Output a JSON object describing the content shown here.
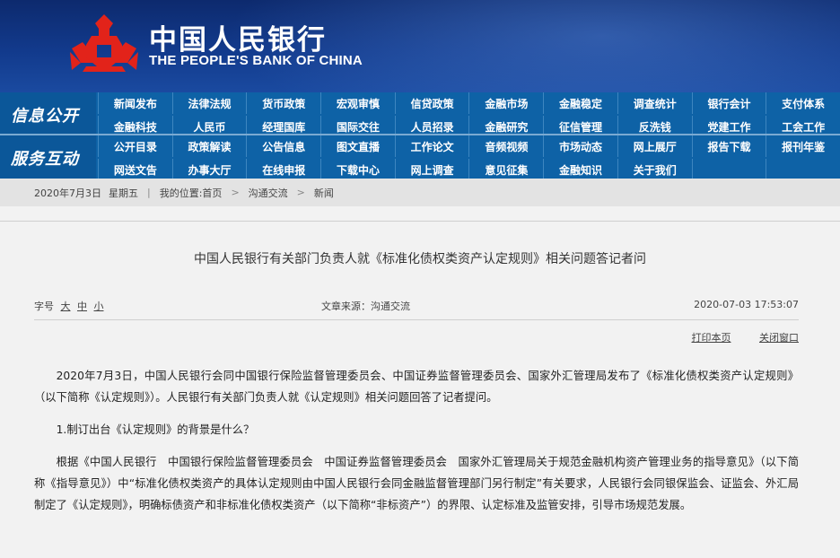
{
  "header": {
    "cn_name": "中国人民银行",
    "en_name": "THE PEOPLE'S BANK OF CHINA",
    "logo_icon": "pboc-emblem-icon",
    "colors": {
      "banner": "#0d2a6e",
      "nav": "#0e62a6",
      "logo_red": "#e2231a"
    }
  },
  "nav1": {
    "tag": "信息公开",
    "items": [
      "新闻发布",
      "法律法规",
      "货币政策",
      "宏观审慎",
      "信贷政策",
      "金融市场",
      "金融稳定",
      "调查统计",
      "银行会计",
      "支付体系",
      "金融科技",
      "人民币",
      "经理国库",
      "国际交往",
      "人员招录",
      "金融研究",
      "征信管理",
      "反洗钱",
      "党建工作",
      "工会工作"
    ]
  },
  "nav2": {
    "tag": "服务互动",
    "items": [
      "公开目录",
      "政策解读",
      "公告信息",
      "图文直播",
      "工作论文",
      "音频视频",
      "市场动态",
      "网上展厅",
      "报告下载",
      "报刊年鉴",
      "网送文告",
      "办事大厅",
      "在线申报",
      "下载中心",
      "网上调查",
      "意见征集",
      "金融知识",
      "关于我们",
      "",
      ""
    ]
  },
  "breadcrumb": {
    "date": "2020年7月3日",
    "weekday": "星期五",
    "location_label": "我的位置:首页",
    "level1": "沟通交流",
    "level2": "新闻",
    "separator": ">"
  },
  "article": {
    "title": "中国人民银行有关部门负责人就《标准化债权类资产认定规则》相关问题答记者问",
    "font_size_label": "字号",
    "font_large": "大",
    "font_medium": "中",
    "font_small": "小",
    "source": "文章来源：沟通交流",
    "timestamp": "2020-07-03  17:53:07",
    "print_label": "打印本页",
    "close_label": "关闭窗口",
    "paragraphs": [
      "2020年7月3日，中国人民银行会同中国银行保险监督管理委员会、中国证券监督管理委员会、国家外汇管理局发布了《标准化债权类资产认定规则》（以下简称《认定规则》）。人民银行有关部门负责人就《认定规则》相关问题回答了记者提问。",
      "1.制订出台《认定规则》的背景是什么？",
      "根据《中国人民银行　中国银行保险监督管理委员会　中国证券监督管理委员会　国家外汇管理局关于规范金融机构资产管理业务的指导意见》（以下简称《指导意见》）中“标准化债权类资产的具体认定规则由中国人民银行会同金融监督管理部门另行制定”有关要求，人民银行会同银保监会、证监会、外汇局制定了《认定规则》，明确标债资产和非标准化债权类资产（以下简称“非标资产”）的界限、认定标准及监管安排，引导市场规范发展。"
    ]
  }
}
